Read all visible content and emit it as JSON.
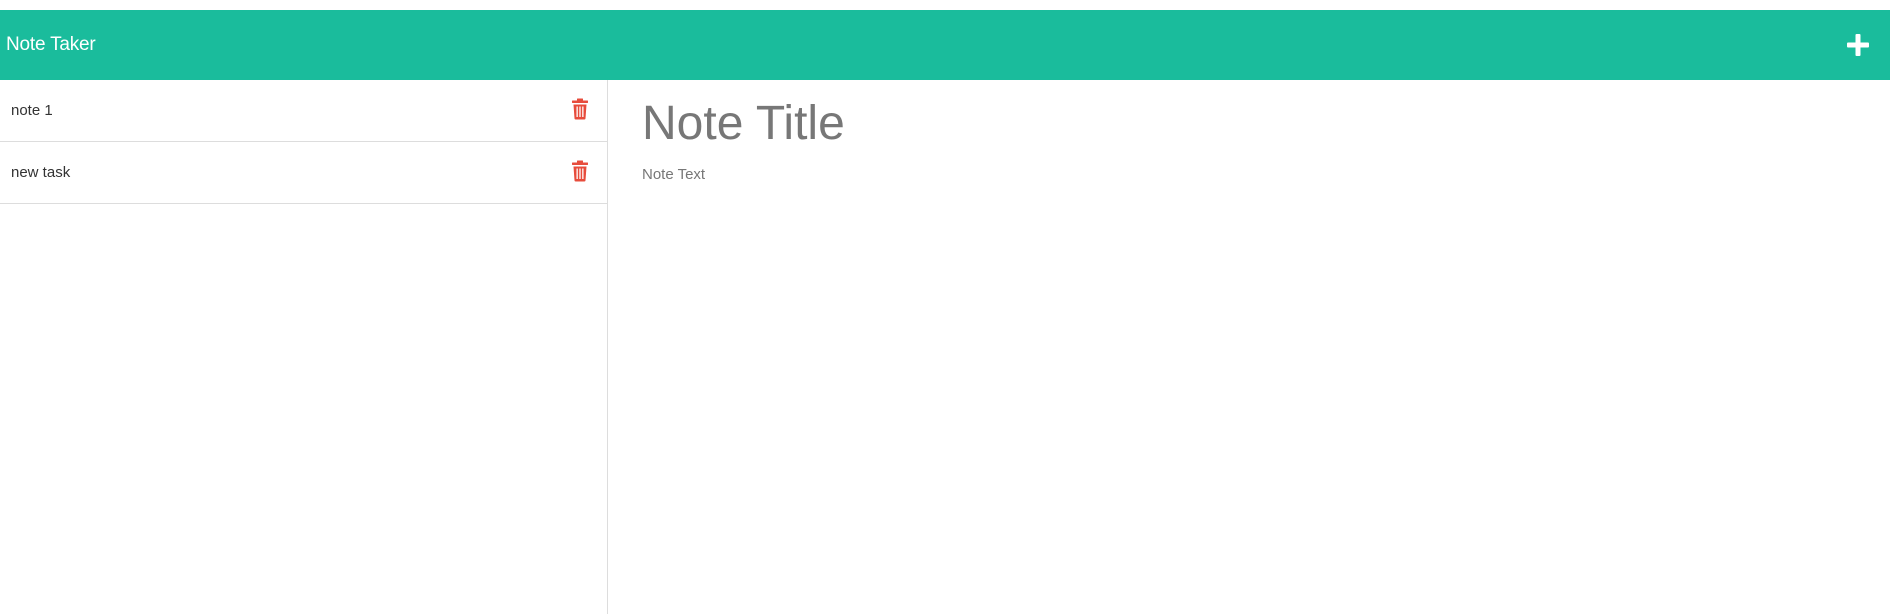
{
  "navbar": {
    "brand": "Note Taker",
    "add_icon": "plus-icon",
    "color": "#1abc9c"
  },
  "sidebar": {
    "notes": [
      {
        "label": "note 1",
        "delete_icon": "trash-icon"
      },
      {
        "label": "new task",
        "delete_icon": "trash-icon"
      }
    ],
    "delete_color": "#e74c3c"
  },
  "editor": {
    "title_placeholder": "Note Title",
    "text_placeholder": "Note Text"
  }
}
